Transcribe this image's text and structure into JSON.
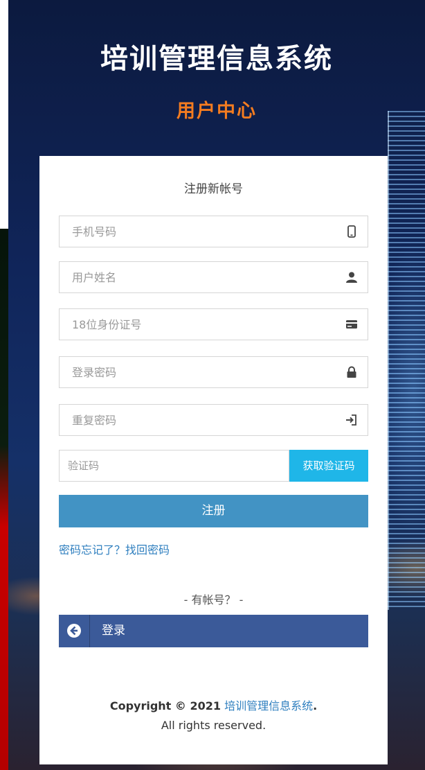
{
  "header": {
    "title": "培训管理信息系统",
    "subtitle": "用户中心"
  },
  "form": {
    "title": "注册新帐号",
    "fields": [
      {
        "placeholder": "手机号码",
        "icon": "mobile-icon"
      },
      {
        "placeholder": "用户姓名",
        "icon": "user-icon"
      },
      {
        "placeholder": "18位身份证号",
        "icon": "id-card-icon"
      },
      {
        "placeholder": "登录密码",
        "icon": "lock-icon"
      },
      {
        "placeholder": "重复密码",
        "icon": "sign-in-icon"
      }
    ],
    "code": {
      "placeholder": "验证码",
      "button_label": "获取验证码"
    },
    "register_label": "注册",
    "forgot_label": "密码忘记了？找回密码",
    "have_account_label": "- 有帐号？ -",
    "login_label": "登录"
  },
  "footer": {
    "copyright_prefix": "Copyright © 2021",
    "brand": "培训管理信息系统",
    "suffix": ".",
    "rights": "All rights reserved."
  },
  "colors": {
    "accent_orange": "#f47c20",
    "register_button": "#4293c4",
    "get_code_button": "#1fb6e8",
    "login_button": "#3b5a99",
    "link": "#2f7fbf"
  }
}
